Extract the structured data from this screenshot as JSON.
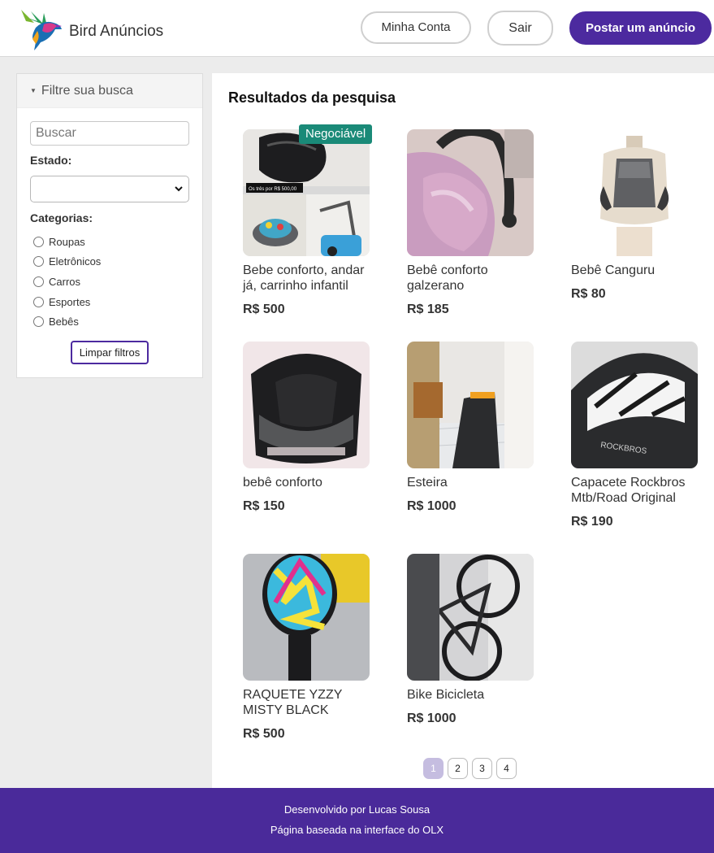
{
  "header": {
    "brand": "Bird Anúncios",
    "account_label": "Minha Conta",
    "logout_label": "Sair",
    "post_label": "Postar um anúncio"
  },
  "filters": {
    "title": "Filtre sua busca",
    "search_placeholder": "Buscar",
    "state_label": "Estado:",
    "state_value": "",
    "categories_label": "Categorias:",
    "categories": [
      "Roupas",
      "Eletrônicos",
      "Carros",
      "Esportes",
      "Bebês"
    ],
    "clear_label": "Limpar filtros"
  },
  "results": {
    "title": "Resultados da pesquisa",
    "items": [
      {
        "title": "Bebe conforto, andar já, carrinho infantil",
        "price": "R$ 500",
        "badge": "Negociável",
        "thumb_text": "Os três por R$ 500,00"
      },
      {
        "title": "Bebê conforto galzerano",
        "price": "R$ 185"
      },
      {
        "title": "Bebê Canguru",
        "price": "R$ 80"
      },
      {
        "title": "bebê conforto",
        "price": "R$ 150"
      },
      {
        "title": "Esteira",
        "price": "R$ 1000"
      },
      {
        "title": "Capacete Rockbros Mtb/Road Original",
        "price": "R$ 190",
        "thumb_text": "ROCKBROS"
      },
      {
        "title": "RAQUETE YZZY MISTY BLACK",
        "price": "R$ 500"
      },
      {
        "title": "Bike Bicicleta",
        "price": "R$ 1000"
      }
    ]
  },
  "pagination": {
    "pages": [
      "1",
      "2",
      "3",
      "4"
    ],
    "current": "1"
  },
  "footer": {
    "line1": "Desenvolvido por Lucas Sousa",
    "line2": "Página baseada na interface do OLX"
  },
  "colors": {
    "accent": "#4c2a9f",
    "badge": "#1a8a78",
    "footer": "#4a2a9a"
  }
}
